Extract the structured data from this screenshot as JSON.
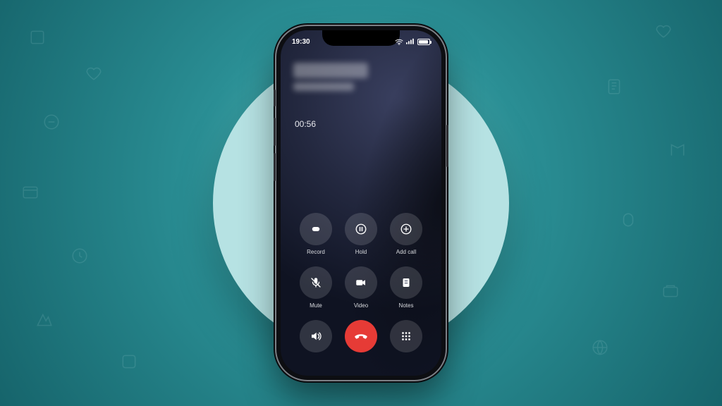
{
  "status": {
    "time": "19:30",
    "wifi_icon": "wifi-icon",
    "signal_icon": "signal-icon",
    "battery_icon": "battery-icon"
  },
  "call": {
    "caller_name_blurred": true,
    "duration": "00:56"
  },
  "controls": {
    "record": "Record",
    "hold": "Hold",
    "add_call": "Add call",
    "mute": "Mute",
    "video": "Video",
    "notes": "Notes",
    "speaker": "",
    "end": "",
    "keypad": ""
  },
  "colors": {
    "end_call": "#e63b36",
    "button_bg": "rgba(255,255,255,0.14)"
  }
}
